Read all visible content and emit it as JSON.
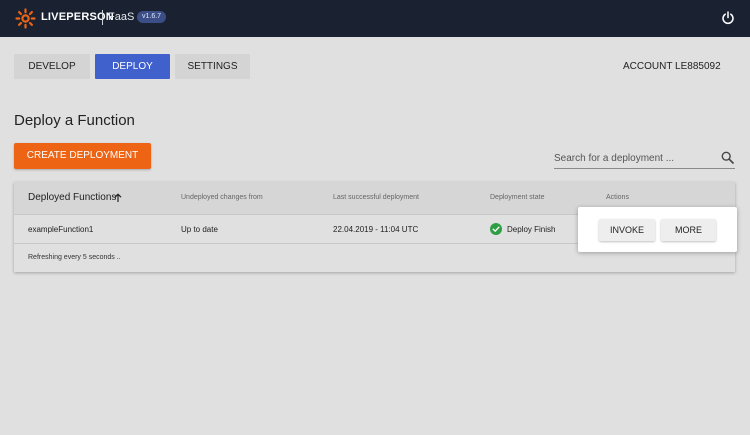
{
  "header": {
    "brand": "LIVEPERSON",
    "product": "FaaS",
    "version": "v1.6.7",
    "logo_icon": "sunburst-logo-icon",
    "power_icon": "power-icon"
  },
  "nav": {
    "tabs": [
      {
        "label": "DEVELOP",
        "active": false
      },
      {
        "label": "DEPLOY",
        "active": true
      },
      {
        "label": "SETTINGS",
        "active": false
      }
    ],
    "account": "ACCOUNT LE885092"
  },
  "main": {
    "title": "Deploy a Function",
    "create_button": "CREATE DEPLOYMENT",
    "search": {
      "placeholder": "Search for a deployment ...",
      "value": "",
      "icon": "search-icon"
    }
  },
  "table": {
    "columns": [
      "Deployed Functions",
      "Undeployed changes from",
      "Last successful deployment",
      "Deployment state",
      "Actions"
    ],
    "sort_icon": "arrow-up-icon",
    "rows": [
      {
        "name": "exampleFunction1",
        "changes": "Up to date",
        "last_deploy": "22.04.2019 - 11:04 UTC",
        "state": "Deploy Finish",
        "state_icon": "check-circle-icon",
        "actions": [
          "INVOKE",
          "MORE"
        ]
      }
    ],
    "footer": "Refreshing every 5 seconds .."
  },
  "colors": {
    "topbar": "#1a2232",
    "accent": "#4060cc",
    "create": "#ec6414",
    "logo": "#ec6414",
    "success": "#2e9e43",
    "background": "#e0e0e0"
  }
}
